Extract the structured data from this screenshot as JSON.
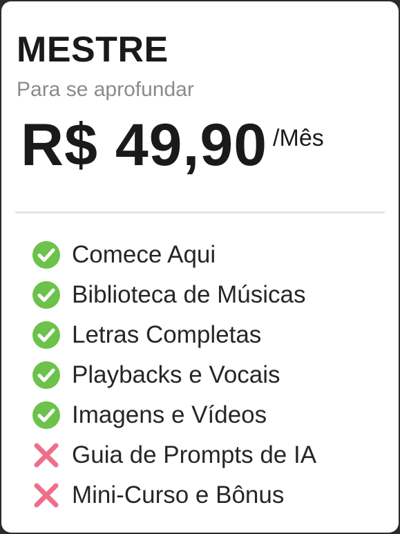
{
  "plan": {
    "name": "MESTRE",
    "subtitle": "Para se aprofundar",
    "price": "R$ 49,90",
    "period": "/Mês"
  },
  "features": [
    {
      "label": "Comece Aqui",
      "included": true,
      "icon": "check-circle-icon"
    },
    {
      "label": "Biblioteca de Músicas",
      "included": true,
      "icon": "check-circle-icon"
    },
    {
      "label": "Letras Completas",
      "included": true,
      "icon": "check-circle-icon"
    },
    {
      "label": "Playbacks e Vocais",
      "included": true,
      "icon": "check-circle-icon"
    },
    {
      "label": "Imagens e Vídeos",
      "included": true,
      "icon": "check-circle-icon"
    },
    {
      "label": "Guia de Prompts de IA",
      "included": false,
      "icon": "cross-icon"
    },
    {
      "label": "Mini-Curso e Bônus",
      "included": false,
      "icon": "cross-icon"
    }
  ],
  "colors": {
    "check": "#6cc24a",
    "cross": "#ef6f8a",
    "card": "#ffffff",
    "background": "#2b2b2b",
    "subtitle": "#8b8b8b"
  }
}
